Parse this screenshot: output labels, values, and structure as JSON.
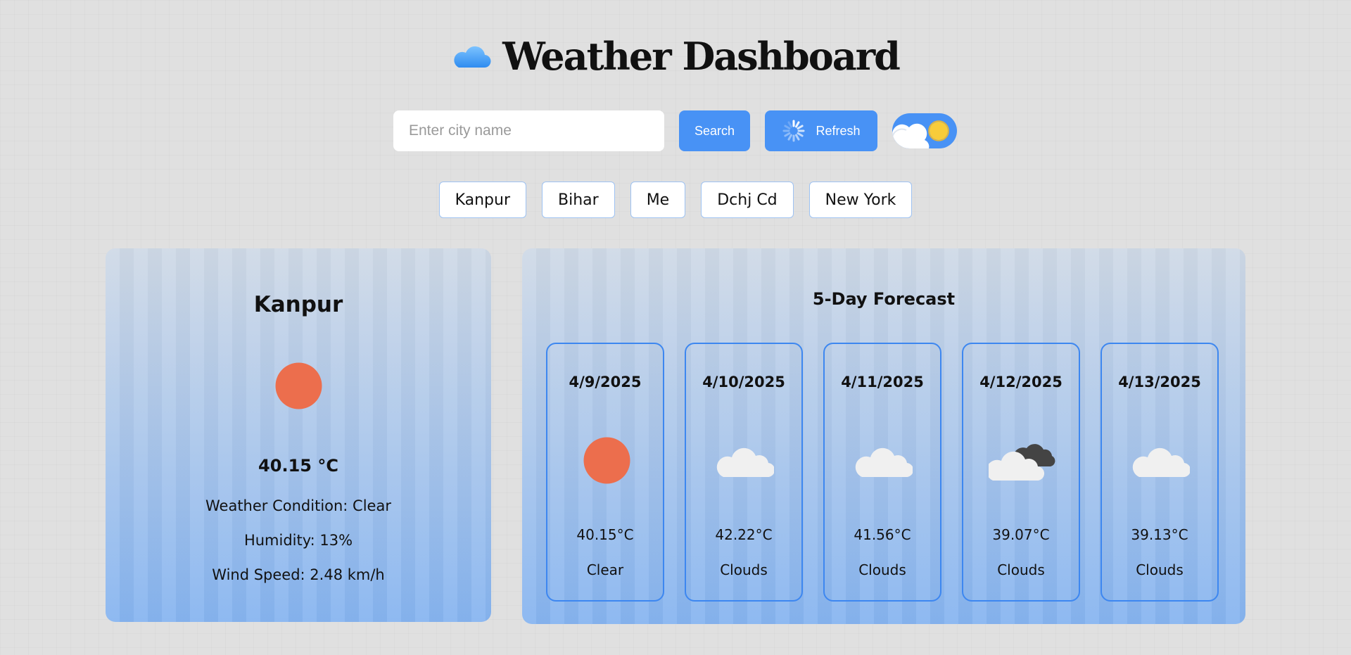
{
  "app": {
    "title": "Weather Dashboard",
    "logo_icon": "cloud-icon"
  },
  "search": {
    "placeholder": "Enter city name",
    "value": "",
    "button_label": "Search"
  },
  "refresh": {
    "label": "Refresh",
    "icon": "spinner-icon"
  },
  "theme_toggle": {
    "icon": "cloud-sun-icon"
  },
  "recent_cities": [
    "Kanpur",
    "Bihar",
    "Me",
    "Dchj Cd",
    "New York"
  ],
  "current": {
    "city": "Kanpur",
    "icon": "sun-icon",
    "temperature": "40.15 °C",
    "condition": "Weather Condition: Clear",
    "humidity": "Humidity: 13%",
    "wind": "Wind Speed: 2.48 km/h"
  },
  "forecast": {
    "title": "5-Day Forecast",
    "days": [
      {
        "date": "4/9/2025",
        "temp": "40.15°C",
        "condition": "Clear",
        "icon": "sun-icon"
      },
      {
        "date": "4/10/2025",
        "temp": "42.22°C",
        "condition": "Clouds",
        "icon": "cloud-icon"
      },
      {
        "date": "4/11/2025",
        "temp": "41.56°C",
        "condition": "Clouds",
        "icon": "cloud-icon"
      },
      {
        "date": "4/12/2025",
        "temp": "39.07°C",
        "condition": "Clouds",
        "icon": "broken-clouds-icon"
      },
      {
        "date": "4/13/2025",
        "temp": "39.13°C",
        "condition": "Clouds",
        "icon": "cloud-icon"
      }
    ]
  },
  "colors": {
    "accent": "#4892f5",
    "sun": "#ec6e4d",
    "cloud": "#f0f0f0",
    "dark_cloud": "#444444"
  }
}
